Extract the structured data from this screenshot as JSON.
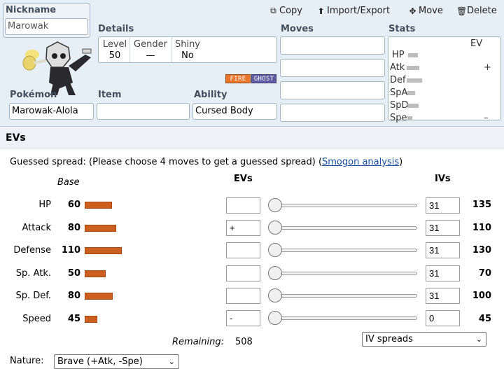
{
  "toolbar": {
    "copy": "Copy",
    "import_export": "Import/Export",
    "move": "Move",
    "delete": "Delete"
  },
  "set": {
    "nickname_label": "Nickname",
    "nickname_value": "Marowak",
    "details_label": "Details",
    "level_label": "Level",
    "level_value": "50",
    "gender_label": "Gender",
    "gender_value": "—",
    "shiny_label": "Shiny",
    "shiny_value": "No",
    "types": [
      {
        "label": "FIRE",
        "color": "#e8762b"
      },
      {
        "label": "GHOST",
        "color": "#5e5ca3"
      }
    ],
    "moves_label": "Moves",
    "moves": [
      "",
      "",
      "",
      ""
    ],
    "pokemon_label": "Pokémon",
    "pokemon_value": "Marowak-Alola",
    "item_label": "Item",
    "item_value": "",
    "ability_label": "Ability",
    "ability_value": "Cursed Body",
    "stats_label": "Stats",
    "stats_ev_label": "EV",
    "stats_rows": [
      {
        "label": "HP",
        "ev": ""
      },
      {
        "label": "Atk",
        "ev": "+"
      },
      {
        "label": "Def",
        "ev": ""
      },
      {
        "label": "SpA",
        "ev": ""
      },
      {
        "label": "SpD",
        "ev": ""
      },
      {
        "label": "Spe",
        "ev": "–"
      }
    ]
  },
  "evs": {
    "header": "EVs",
    "hint_prefix": "Guessed spread: (Please choose 4 moves to get a guessed spread) (",
    "hint_link": "Smogon analysis",
    "hint_suffix": ")",
    "col_base": "Base",
    "col_evs": "EVs",
    "col_ivs": "IVs",
    "rows": [
      {
        "name": "HP",
        "base": "60",
        "ev": "",
        "iv": "31",
        "total": "135",
        "bar_color": "#cc6a1f"
      },
      {
        "name": "Attack",
        "base": "80",
        "ev": "+",
        "iv": "31",
        "total": "110",
        "bar_color": "#cc5f1f"
      },
      {
        "name": "Defense",
        "base": "110",
        "ev": "",
        "iv": "31",
        "total": "130",
        "bar_color": "#cc6a1f"
      },
      {
        "name": "Sp. Atk.",
        "base": "50",
        "ev": "",
        "iv": "31",
        "total": "70",
        "bar_color": "#cc5f1f"
      },
      {
        "name": "Sp. Def.",
        "base": "80",
        "ev": "",
        "iv": "31",
        "total": "100",
        "bar_color": "#cc5f1f"
      },
      {
        "name": "Speed",
        "base": "45",
        "ev": "-",
        "iv": "0",
        "total": "45",
        "bar_color": "#cc6a1f"
      }
    ],
    "remaining_label": "Remaining:",
    "remaining_value": "508",
    "iv_spreads_label": "IV spreads",
    "nature_label": "Nature:",
    "nature_value": "Brave (+Atk, -Spe)"
  }
}
